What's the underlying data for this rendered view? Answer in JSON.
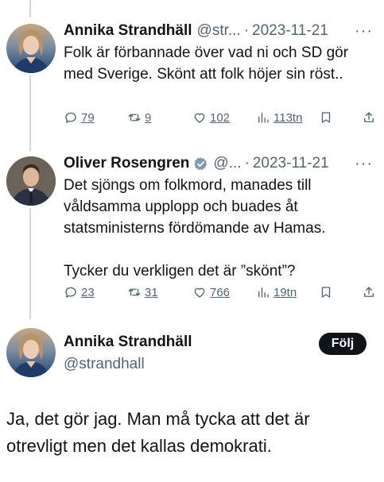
{
  "thread": [
    {
      "name": "Annika Strandhäll",
      "handle": "@str...",
      "separator": "·",
      "date": "2023-11-21",
      "more": "···",
      "text": [
        "Folk är förbannade över vad ni och SD gör med Sverige. Skönt att folk höjer sin röst.."
      ],
      "replies": "79",
      "retweets": "9",
      "likes": "102",
      "views": "113tn",
      "verified": false
    },
    {
      "name": "Oliver Rosengren",
      "handle": "@...",
      "separator": "·",
      "date": "2023-11-21",
      "more": "···",
      "text": [
        "Det sjöngs om folkmord, manades till våldsamma upplopp och buades åt statsministerns fördömande av Hamas.",
        "Tycker du verkligen det är ”skönt”?"
      ],
      "replies": "23",
      "retweets": "31",
      "likes": "766",
      "views": "19tn",
      "verified": true
    }
  ],
  "main_tweet": {
    "name": "Annika Strandhäll",
    "handle": "@strandhall",
    "follow_label": "Följ",
    "text": "Ja, det gör jag. Man må tycka att det är otrevligt men det kallas demokrati."
  },
  "icons": {
    "reply": "reply-icon",
    "retweet": "retweet-icon",
    "like": "heart-icon",
    "views": "views-icon",
    "bookmark": "bookmark-icon",
    "share": "share-icon",
    "verified": "verified-badge-icon"
  },
  "colors": {
    "text": "#0f1419",
    "secondary": "#536471",
    "thread_line": "#cfd9de",
    "follow_button": "#0f1419"
  }
}
